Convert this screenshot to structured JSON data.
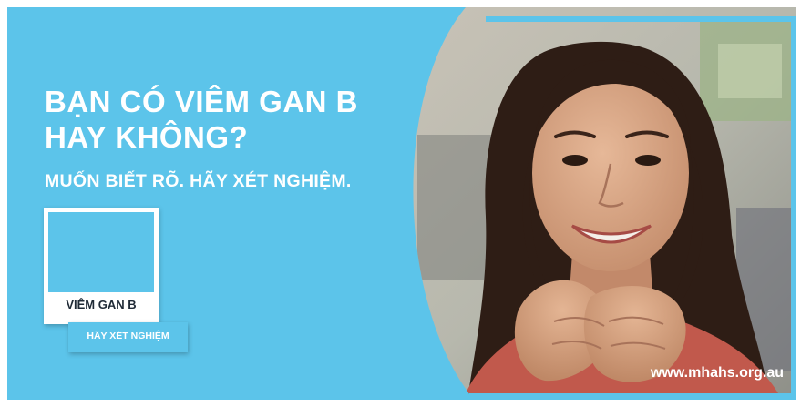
{
  "headline": {
    "line1": "BẠN CÓ VIÊM GAN B",
    "line2": "HAY KHÔNG?"
  },
  "subline": "MUỐN BIẾT RÕ. HÃY XÉT NGHIỆM.",
  "swatch": {
    "label": "VIÊM GAN B"
  },
  "tag": {
    "label": "HÃY XÉT NGHIỆM"
  },
  "url": "www.mhahs.org.au",
  "colors": {
    "brand_blue": "#5cc4ea",
    "white": "#ffffff",
    "label_dark": "#1f2a36"
  }
}
